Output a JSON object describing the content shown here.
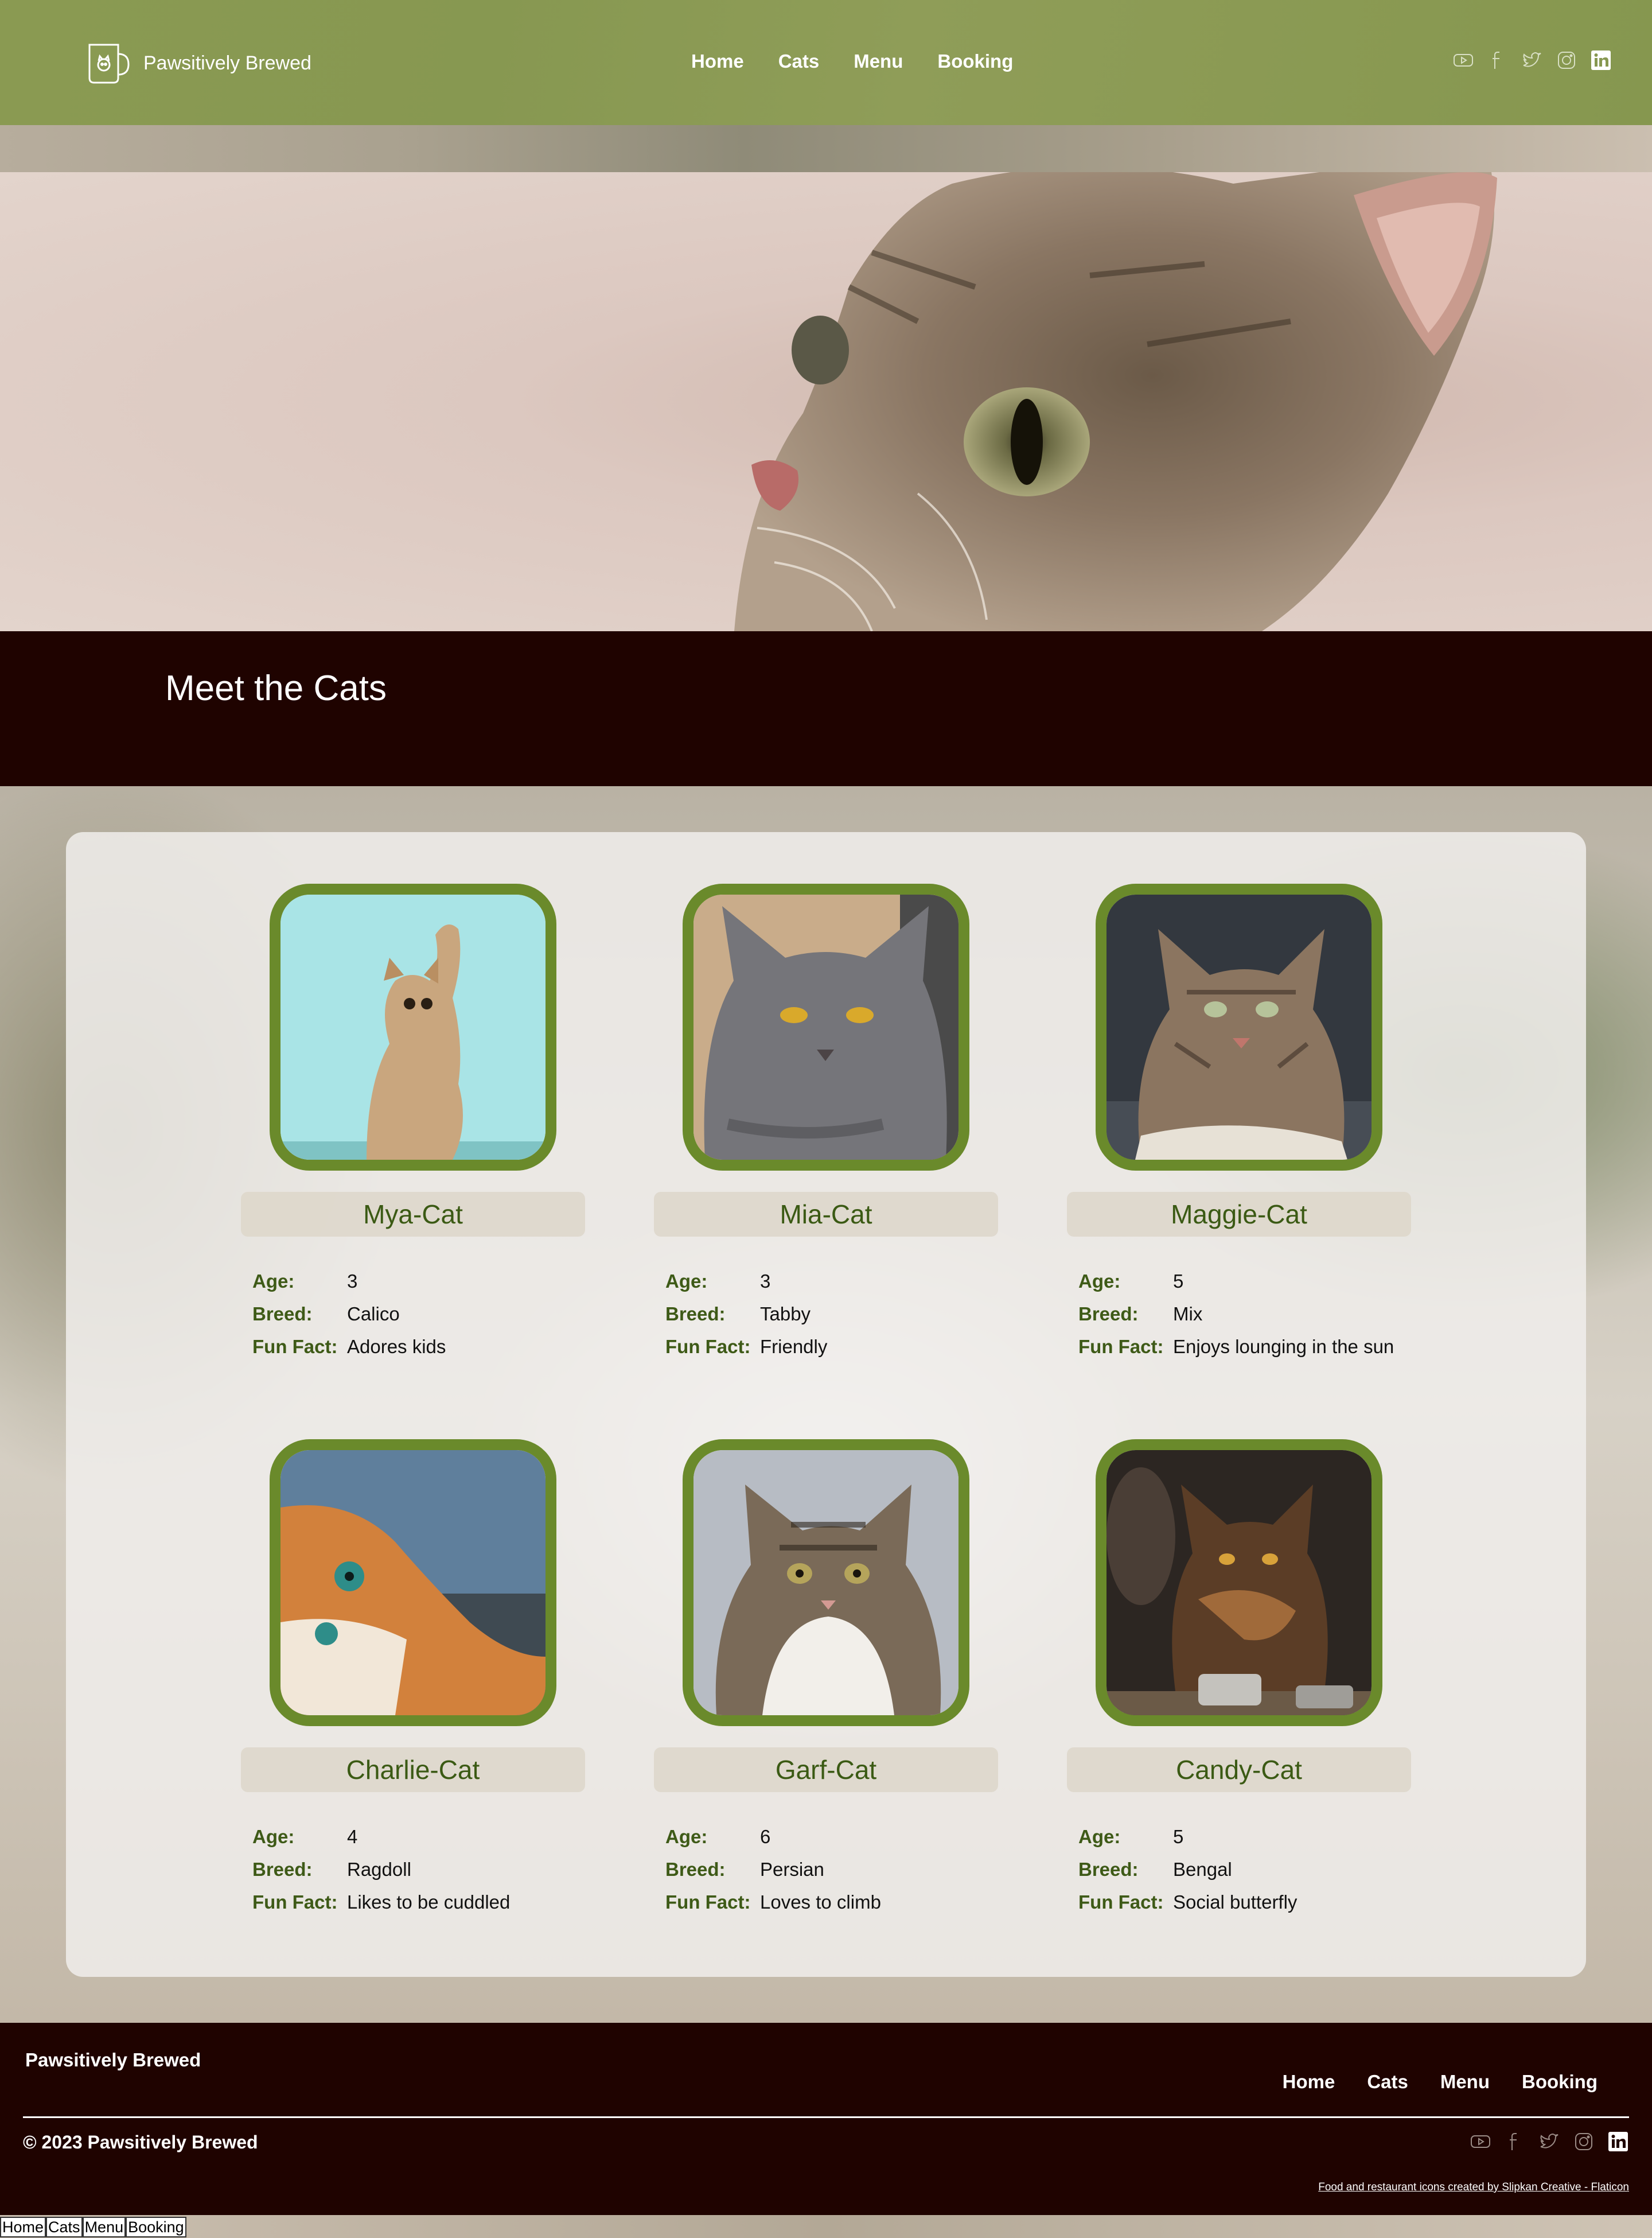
{
  "header": {
    "brand": "Pawsitively Brewed",
    "nav": [
      "Home",
      "Cats",
      "Menu",
      "Booking"
    ],
    "social_icons": [
      "youtube-icon",
      "facebook-icon",
      "twitter-icon",
      "instagram-icon",
      "linkedin-icon"
    ]
  },
  "meet": {
    "title": "Meet the Cats"
  },
  "labels": {
    "age": "Age:",
    "breed": "Breed:",
    "fun_fact": "Fun Fact:"
  },
  "cats": [
    {
      "name": "Mya-Cat",
      "age": "3",
      "breed": "Calico",
      "fun_fact": "Adores kids"
    },
    {
      "name": "Mia-Cat",
      "age": "3",
      "breed": "Tabby",
      "fun_fact": "Friendly"
    },
    {
      "name": "Maggie-Cat",
      "age": "5",
      "breed": "Mix",
      "fun_fact": "Enjoys lounging in the sun"
    },
    {
      "name": "Charlie-Cat",
      "age": "4",
      "breed": "Ragdoll",
      "fun_fact": "Likes to be cuddled"
    },
    {
      "name": "Garf-Cat",
      "age": "6",
      "breed": "Persian",
      "fun_fact": "Loves to climb"
    },
    {
      "name": "Candy-Cat",
      "age": "5",
      "breed": "Bengal",
      "fun_fact": "Social butterfly"
    }
  ],
  "footer": {
    "brand": "Pawsitively Brewed",
    "nav": [
      "Home",
      "Cats",
      "Menu",
      "Booking"
    ],
    "copyright": "© 2023 Pawsitively Brewed",
    "credit": "Food and restaurant icons created by Slipkan Creative - Flaticon"
  },
  "bottom_links": [
    "Home",
    "Cats",
    "Menu",
    "Booking"
  ],
  "colors": {
    "header_green": "#879851",
    "dark_band": "#1f0300",
    "accent_green": "#6a8a2b",
    "label_green": "#3e5a17"
  }
}
